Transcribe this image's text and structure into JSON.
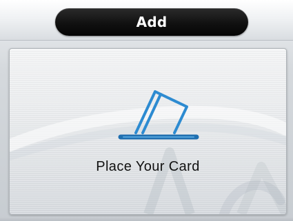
{
  "header": {
    "title": "Add"
  },
  "main": {
    "icon": "card-swipe-icon",
    "instruction": "Place Your Card"
  },
  "colors": {
    "header_pill": "#111111",
    "panel": "#e6e8eb",
    "icon_blue": "#2d8bd1"
  }
}
